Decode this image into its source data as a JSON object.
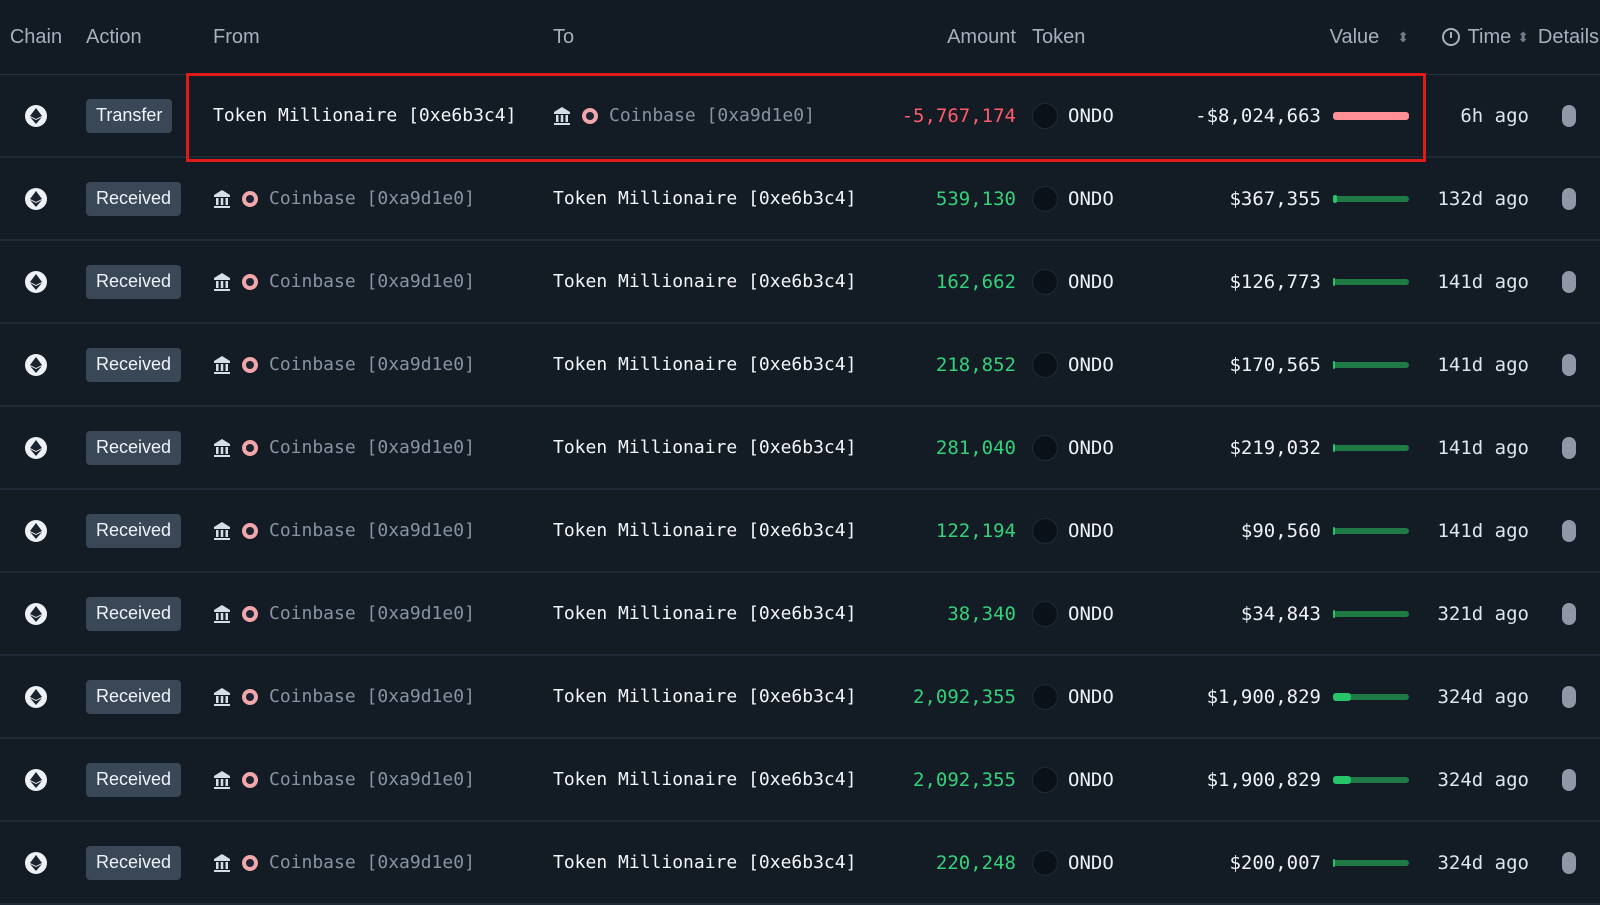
{
  "headers": {
    "chain": "Chain",
    "action": "Action",
    "from": "From",
    "to": "To",
    "amount": "Amount",
    "token": "Token",
    "value": "Value",
    "time": "Time",
    "details": "Details"
  },
  "colors": {
    "positive": "#33d17a",
    "negative": "#ff5c6c",
    "bar_green": "#27c46a",
    "bar_red": "#ff8f97",
    "highlight": "#e01919"
  },
  "rows": [
    {
      "action": "Transfer",
      "from": "Token Millionaire [0xe6b3c4]",
      "to": "Coinbase [0xa9d1e0]",
      "amount": "-5,767,174",
      "token": "ONDO",
      "value": "-$8,024,663",
      "value_bar_fraction": 1.0,
      "bar_color": "red",
      "time": "6h ago",
      "direction": "out"
    },
    {
      "action": "Received",
      "from": "Coinbase [0xa9d1e0]",
      "to": "Token Millionaire [0xe6b3c4]",
      "amount": "539,130",
      "token": "ONDO",
      "value": "$367,355",
      "value_bar_fraction": 0.05,
      "bar_color": "green",
      "time": "132d ago",
      "direction": "in"
    },
    {
      "action": "Received",
      "from": "Coinbase [0xa9d1e0]",
      "to": "Token Millionaire [0xe6b3c4]",
      "amount": "162,662",
      "token": "ONDO",
      "value": "$126,773",
      "value_bar_fraction": 0.02,
      "bar_color": "green",
      "time": "141d ago",
      "direction": "in"
    },
    {
      "action": "Received",
      "from": "Coinbase [0xa9d1e0]",
      "to": "Token Millionaire [0xe6b3c4]",
      "amount": "218,852",
      "token": "ONDO",
      "value": "$170,565",
      "value_bar_fraction": 0.02,
      "bar_color": "green",
      "time": "141d ago",
      "direction": "in"
    },
    {
      "action": "Received",
      "from": "Coinbase [0xa9d1e0]",
      "to": "Token Millionaire [0xe6b3c4]",
      "amount": "281,040",
      "token": "ONDO",
      "value": "$219,032",
      "value_bar_fraction": 0.03,
      "bar_color": "green",
      "time": "141d ago",
      "direction": "in"
    },
    {
      "action": "Received",
      "from": "Coinbase [0xa9d1e0]",
      "to": "Token Millionaire [0xe6b3c4]",
      "amount": "122,194",
      "token": "ONDO",
      "value": "$90,560",
      "value_bar_fraction": 0.01,
      "bar_color": "green",
      "time": "141d ago",
      "direction": "in"
    },
    {
      "action": "Received",
      "from": "Coinbase [0xa9d1e0]",
      "to": "Token Millionaire [0xe6b3c4]",
      "amount": "38,340",
      "token": "ONDO",
      "value": "$34,843",
      "value_bar_fraction": 0.01,
      "bar_color": "green",
      "time": "321d ago",
      "direction": "in"
    },
    {
      "action": "Received",
      "from": "Coinbase [0xa9d1e0]",
      "to": "Token Millionaire [0xe6b3c4]",
      "amount": "2,092,355",
      "token": "ONDO",
      "value": "$1,900,829",
      "value_bar_fraction": 0.24,
      "bar_color": "green",
      "time": "324d ago",
      "direction": "in"
    },
    {
      "action": "Received",
      "from": "Coinbase [0xa9d1e0]",
      "to": "Token Millionaire [0xe6b3c4]",
      "amount": "2,092,355",
      "token": "ONDO",
      "value": "$1,900,829",
      "value_bar_fraction": 0.24,
      "bar_color": "green",
      "time": "324d ago",
      "direction": "in"
    },
    {
      "action": "Received",
      "from": "Coinbase [0xa9d1e0]",
      "to": "Token Millionaire [0xe6b3c4]",
      "amount": "220,248",
      "token": "ONDO",
      "value": "$200,007",
      "value_bar_fraction": 0.03,
      "bar_color": "green",
      "time": "324d ago",
      "direction": "in"
    }
  ]
}
